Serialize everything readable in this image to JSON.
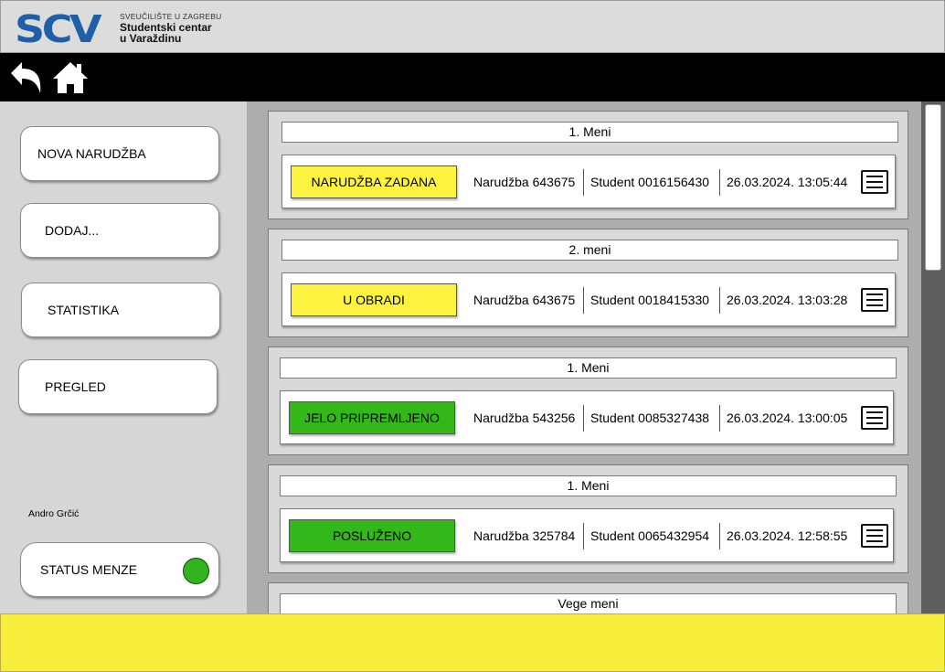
{
  "header": {
    "logo_mark": "SCV",
    "logo_line1": "SVEUČILIŠTE U ZAGREBU",
    "logo_line2": "Studentski centar",
    "logo_line3": "u Varaždinu"
  },
  "nav": {
    "back_icon": "back-arrow-icon",
    "home_icon": "home-icon"
  },
  "sidebar": {
    "buttons": [
      "NOVA NARUDŽBA",
      "DODAJ...",
      "STATISTIKA",
      "PREGLED"
    ],
    "user_name": "Andro Grčić",
    "status_label": "STATUS MENZE",
    "status_color": "#32b41e"
  },
  "colors": {
    "pending": "#fbf33f",
    "done": "#34b819",
    "footer": "#f8ed3b"
  },
  "orders": [
    {
      "menu": "1. Meni",
      "status": "NARUDŽBA ZADANA",
      "status_color": "#fbf33f",
      "order": "Narudžba 643675",
      "student": "Student 0016156430",
      "time": "26.03.2024. 13:05:44"
    },
    {
      "menu": "2. meni",
      "status": "U OBRADI",
      "status_color": "#fbf33f",
      "order": "Narudžba 643675",
      "student": "Student 0018415330",
      "time": "26.03.2024. 13:03:28"
    },
    {
      "menu": "1. Meni",
      "status": "JELO PRIPREMLJENO",
      "status_color": "#34b819",
      "order": "Narudžba 543256",
      "student": "Student 0085327438",
      "time": "26.03.2024. 13:00:05"
    },
    {
      "menu": "1. Meni",
      "status": "POSLUŽENO",
      "status_color": "#34b819",
      "order": "Narudžba 325784",
      "student": "Student 0065432954",
      "time": "26.03.2024. 12:58:55"
    },
    {
      "menu": "Vege meni"
    }
  ]
}
